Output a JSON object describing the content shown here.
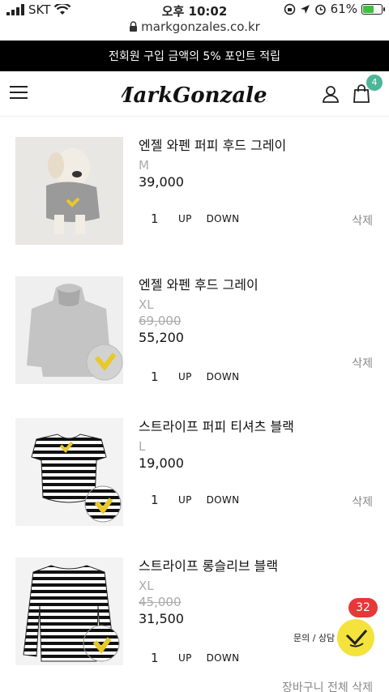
{
  "status_bar": {
    "carrier": "SKT",
    "time": "오후 10:02",
    "battery": "61%",
    "battery_level": 0.61,
    "icons": [
      "signal-icon",
      "wifi-icon",
      "rotation-lock-icon",
      "location-icon",
      "alarm-icon",
      "battery-icon"
    ]
  },
  "browser": {
    "url": "markgonzales.co.kr"
  },
  "promo": {
    "text": "전회원 구입 금액의 5% 포인트 적립"
  },
  "header": {
    "logo_text": "MarkGonzales",
    "cart_count": "4"
  },
  "cart": {
    "items": [
      {
        "name": "엔젤 와펜 퍼피 후드 그레이",
        "option": "M",
        "original_price": "",
        "price": "39,000",
        "qty": "1"
      },
      {
        "name": "엔젤 와펜 후드 그레이",
        "option": "XL",
        "original_price": "69,000",
        "price": "55,200",
        "qty": "1"
      },
      {
        "name": "스트라이프 퍼피 티셔츠 블랙",
        "option": "L",
        "original_price": "",
        "price": "19,000",
        "qty": "1"
      },
      {
        "name": "스트라이프 롱슬리브 블랙",
        "option": "XL",
        "original_price": "45,000",
        "price": "31,500",
        "qty": "1"
      }
    ],
    "up_label": "UP",
    "down_label": "DOWN",
    "delete_label": "삭제",
    "bottom_link": "장바구니 전체 삭제"
  },
  "chat": {
    "label": "문의 / 상담",
    "badge": "32"
  },
  "colors": {
    "promo_bg": "#000000",
    "cart_badge": "#4db59a",
    "chat_bg": "#f3e33c",
    "chat_badge": "#e53838"
  }
}
